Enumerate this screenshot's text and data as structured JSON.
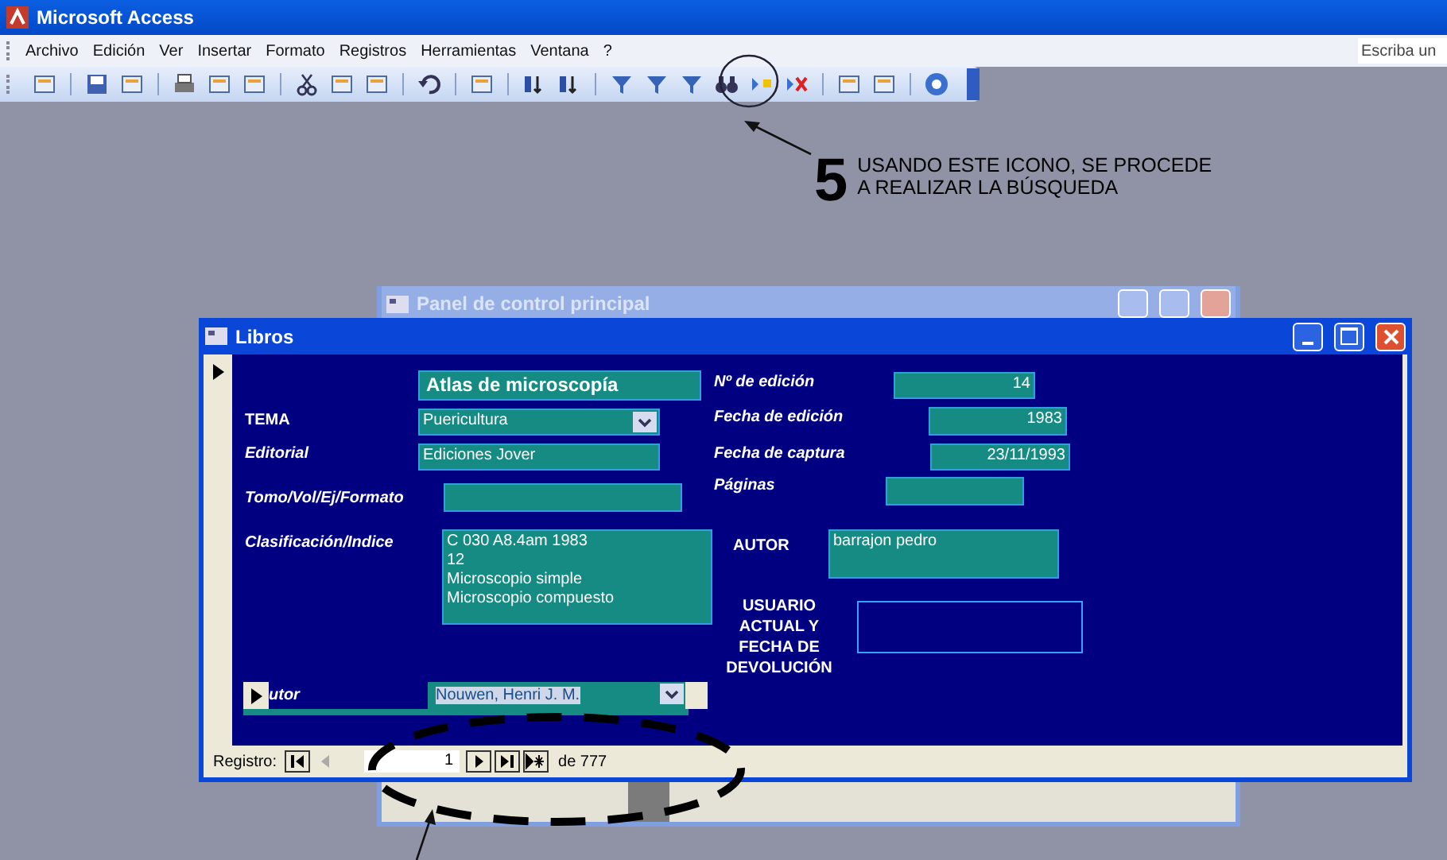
{
  "app_window": {
    "title": "Microsoft Access"
  },
  "menu": [
    "Archivo",
    "Edición",
    "Ver",
    "Insertar",
    "Formato",
    "Registros",
    "Herramientas",
    "Ventana",
    "?"
  ],
  "help_search": {
    "placeholder": "Escriba un"
  },
  "annotation": {
    "step": "5",
    "lines": [
      "USANDO ESTE ICONO, SE PROCEDE",
      "A REALIZAR LA BÚSQUEDA"
    ]
  },
  "background_window": {
    "title": "Panel de control principal"
  },
  "form_window": {
    "title": "Libros",
    "title_field": {
      "value": "Atlas de microscopía"
    },
    "fields": [
      {
        "kind": "combo",
        "label": "TEMA",
        "label_italic": false,
        "value": "Puericultura"
      },
      {
        "kind": "text",
        "label": "Editorial",
        "label_italic": true,
        "value": "Ediciones Jover"
      },
      {
        "kind": "text",
        "label": "Tomo/Vol/Ej/Formato",
        "label_italic": true
      },
      {
        "kind": "memo",
        "label": "Clasificación/Indice",
        "label_italic": true,
        "value": "C 030 A8.4am 1983\n12\nMicroscopio simple\nMicroscopio compuesto"
      },
      {
        "kind": "number",
        "label": "Nº de edición",
        "label_italic": true,
        "value": "14"
      },
      {
        "kind": "number",
        "label": "Fecha de edición",
        "label_italic": true,
        "value": "1983"
      },
      {
        "kind": "number",
        "label": "Fecha de captura",
        "label_italic": true,
        "value": "23/11/1993"
      },
      {
        "kind": "text",
        "label": "Páginas",
        "label_italic": true
      },
      {
        "kind": "memo",
        "label": "AUTOR",
        "label_italic": false,
        "value": "barrajon pedro"
      },
      {
        "kind": "outline",
        "label": "USUARIO ACTUAL Y FECHA DE DEVOLUCIÓN",
        "label_italic": false
      }
    ],
    "subform": {
      "label": "utor",
      "value": "Nouwen, Henri J. M.",
      "highlighted": true
    },
    "navigation": {
      "label": "Registro:",
      "current": "1",
      "total": "de 777",
      "buttons": [
        {
          "kind": "first",
          "disabled": false
        },
        {
          "kind": "prev",
          "disabled": true
        },
        {
          "kind": "next",
          "disabled": false
        },
        {
          "kind": "last",
          "disabled": false
        },
        {
          "kind": "new",
          "disabled": false
        }
      ]
    }
  }
}
